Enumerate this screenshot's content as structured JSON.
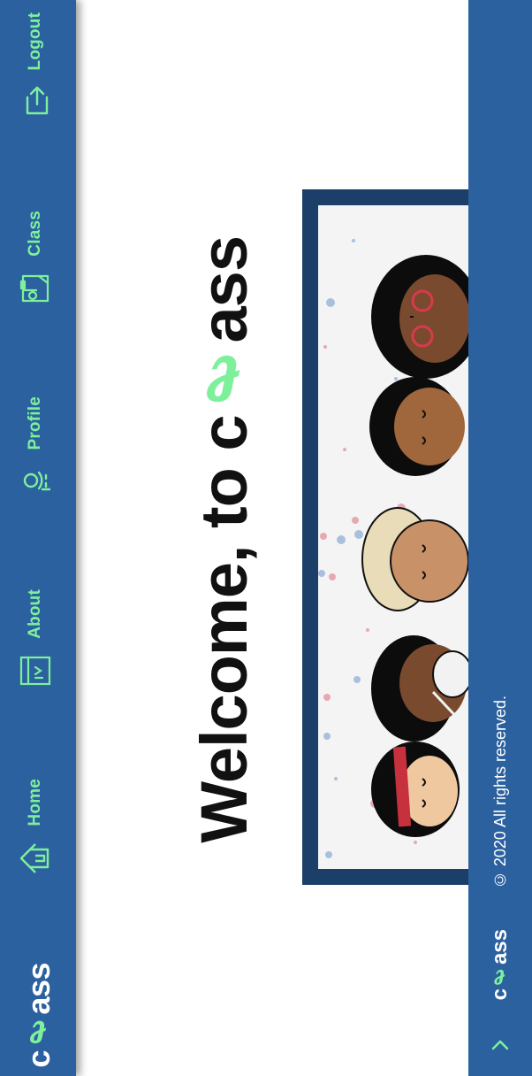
{
  "nav": {
    "brand": {
      "prefix": "c",
      "accent": "ℓ",
      "suffix": "ass"
    },
    "items": [
      {
        "label": "Home",
        "icon": "home-icon"
      },
      {
        "label": "About",
        "icon": "about-icon"
      },
      {
        "label": "Profile",
        "icon": "profile-icon"
      },
      {
        "label": "Class",
        "icon": "class-icon"
      },
      {
        "label": "Logout",
        "icon": "logout-icon"
      }
    ]
  },
  "main": {
    "welcome_prefix": "Welcome, to c",
    "welcome_accent": "ℓ",
    "welcome_suffix": "ass",
    "illustration": "diverse-students-illustration"
  },
  "footer": {
    "brand": {
      "prefix": "c",
      "accent": "ℓ",
      "suffix": "ass"
    },
    "copyright": "© 2020 All rights reserved.",
    "scroll_top_icon": "chevron-up-icon"
  },
  "colors": {
    "primary": "#2c619f",
    "accent": "#7ef09c",
    "frame": "#1b3f68",
    "text": "#111111"
  }
}
